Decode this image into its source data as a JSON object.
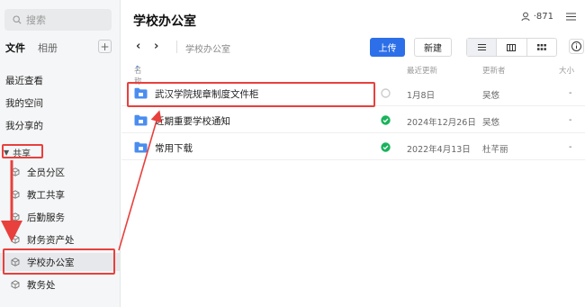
{
  "sidebar": {
    "search_placeholder": "搜索",
    "tabs": [
      {
        "label": "文件"
      },
      {
        "label": "相册"
      }
    ],
    "add_label": "+",
    "nav": [
      {
        "label": "最近查看"
      },
      {
        "label": "我的空间"
      },
      {
        "label": "我分享的"
      }
    ],
    "share_header": "共享",
    "share_items": [
      {
        "label": "全员分区"
      },
      {
        "label": "教工共享"
      },
      {
        "label": "后勤服务"
      },
      {
        "label": "财务资产处"
      },
      {
        "label": "学校办公室"
      },
      {
        "label": "教务处"
      }
    ]
  },
  "main": {
    "title": "学校办公室",
    "member_count": "871",
    "breadcrumb": "学校办公室",
    "upload_label": "上传",
    "new_label": "新建",
    "columns": {
      "name": "名称",
      "updated": "最近更新",
      "updater": "更新者",
      "size": "大小"
    },
    "files": [
      {
        "name": "武汉学院规章制度文件柜",
        "date": "1月8日",
        "updater": "吴悠",
        "size": "-",
        "status": "syncing"
      },
      {
        "name": "近期重要学校通知",
        "date": "2024年12月26日",
        "updater": "吴悠",
        "size": "-",
        "status": "done"
      },
      {
        "name": "常用下载",
        "date": "2022年4月13日",
        "updater": "杜芊丽",
        "size": "-",
        "status": "done"
      }
    ]
  },
  "colors": {
    "accent": "#2d6fe8",
    "highlight": "#e8403d",
    "success": "#19b35c",
    "folder": "#4a8df0"
  }
}
